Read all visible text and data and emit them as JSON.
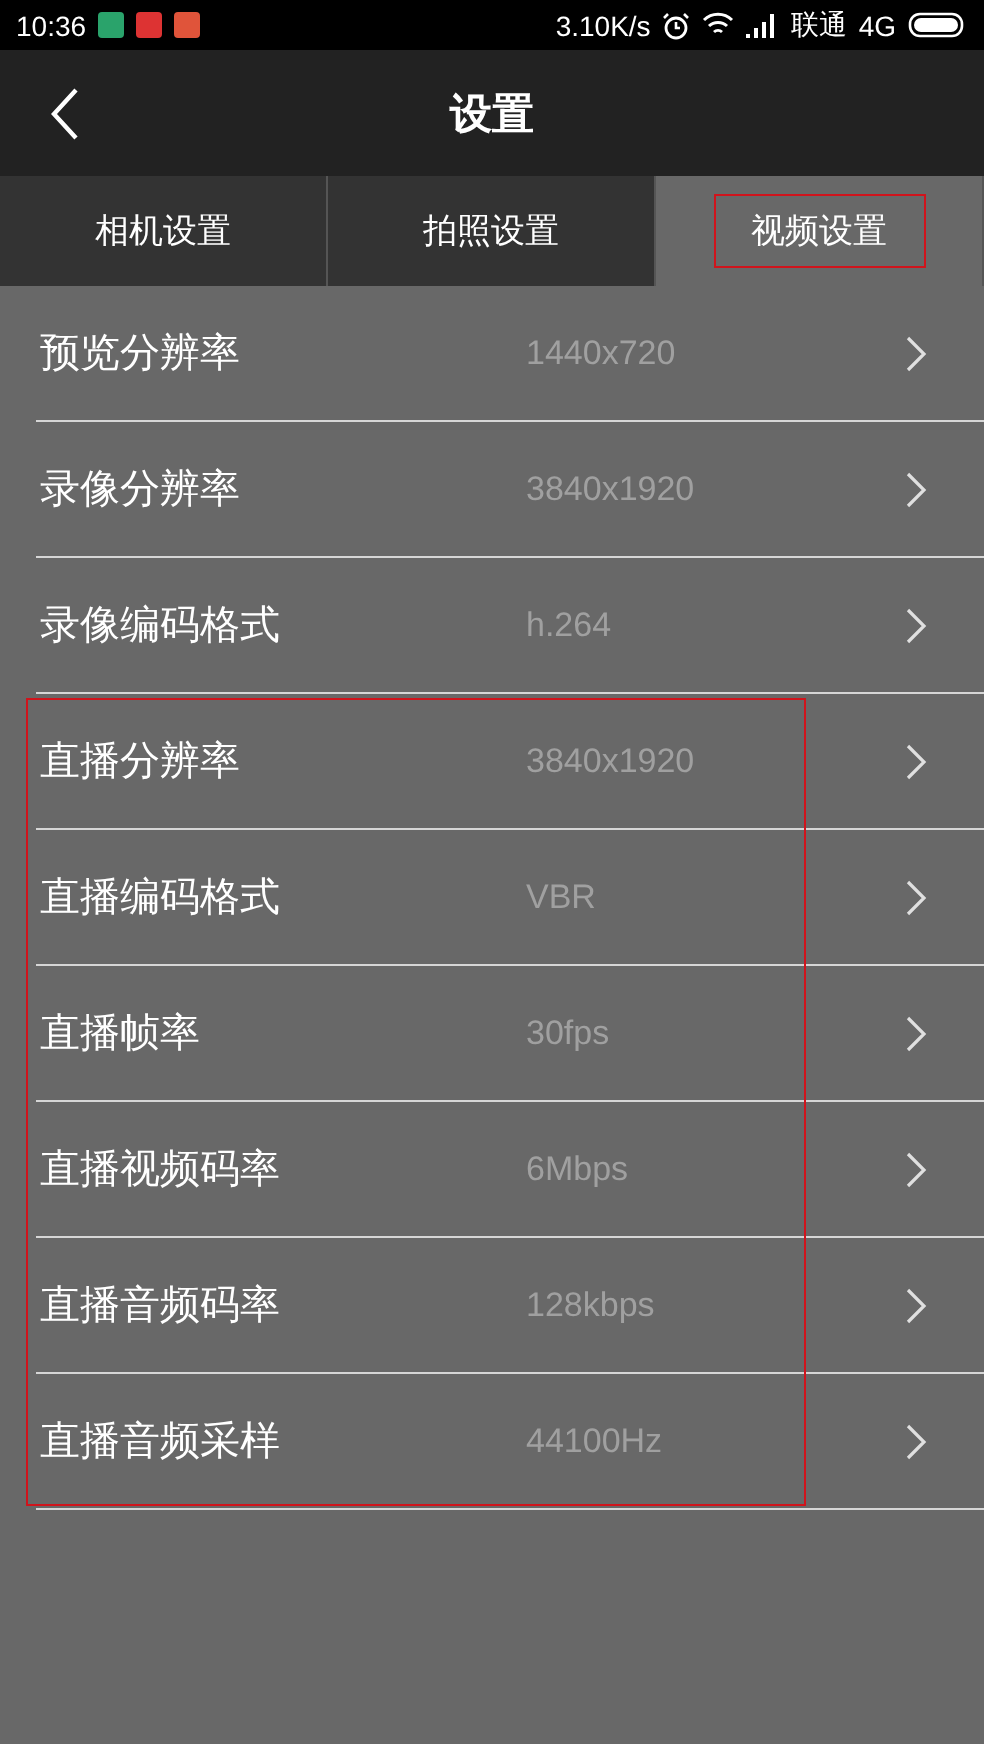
{
  "status_bar": {
    "time": "10:36",
    "speed": "3.10K/s",
    "carrier": "联通",
    "network": "4G"
  },
  "header": {
    "title": "设置"
  },
  "tabs": [
    {
      "label": "相机设置",
      "selected": false,
      "highlighted": false
    },
    {
      "label": "拍照设置",
      "selected": false,
      "highlighted": false
    },
    {
      "label": "视频设置",
      "selected": true,
      "highlighted": true
    }
  ],
  "groups": [
    {
      "highlighted": false,
      "rows": [
        {
          "label": "预览分辨率",
          "value": "1440x720"
        },
        {
          "label": "录像分辨率",
          "value": "3840x1920"
        },
        {
          "label": "录像编码格式",
          "value": "h.264"
        }
      ]
    },
    {
      "highlighted": true,
      "rows": [
        {
          "label": "直播分辨率",
          "value": "3840x1920"
        },
        {
          "label": "直播编码格式",
          "value": "VBR"
        },
        {
          "label": "直播帧率",
          "value": "30fps"
        },
        {
          "label": "直播视频码率",
          "value": "6Mbps"
        },
        {
          "label": "直播音频码率",
          "value": "128kbps"
        },
        {
          "label": "直播音频采样",
          "value": "44100Hz"
        }
      ]
    }
  ]
}
